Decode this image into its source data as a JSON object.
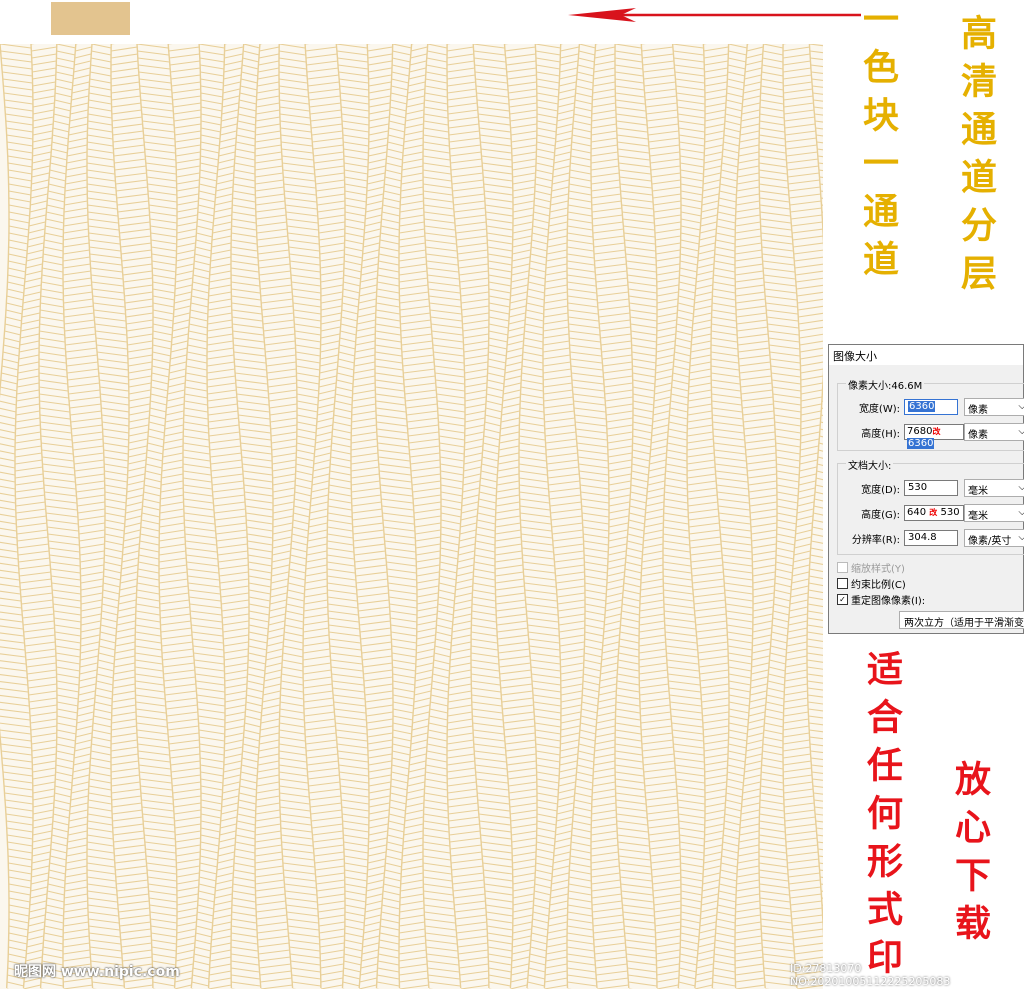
{
  "colors": {
    "gold": "#e3c48f",
    "line_gold": "#e8cf98",
    "brush_gold": "#e5b000",
    "brush_red": "#e8141b",
    "arrow_red": "#d8131c",
    "highlight": "#3573d3"
  },
  "annotations": {
    "one_color_text": "一色块一通道",
    "hd_text": "高清通道分层",
    "suitable_text": "适合任何形式印",
    "download_text": "放心下载"
  },
  "dialog": {
    "title": "图像大小",
    "pixel_dimensions_label": "像素大小:46.6M",
    "width_label": "宽度(W):",
    "width_value": "6360",
    "width_unit": "像素",
    "height_label": "高度(H):",
    "height_value_old": "7680",
    "height_mark": "改",
    "height_value": "6360",
    "height_unit": "像素",
    "document_size_label": "文档大小:",
    "doc_width_label": "宽度(D):",
    "doc_width_value": "530",
    "doc_width_unit": "毫米",
    "doc_height_label": "高度(G):",
    "doc_height_value_old": "640",
    "doc_height_mark": "改",
    "doc_height_value": "530",
    "doc_height_unit": "毫米",
    "resolution_label": "分辨率(R):",
    "resolution_value": "304.8",
    "resolution_unit": "像素/英寸",
    "scale_styles_label": "缩放样式(Y)",
    "constrain_label": "约束比例(C)",
    "resample_label": "重定图像像素(I):",
    "resample_method": "两次立方（适用于平滑渐变"
  },
  "watermark": {
    "site": "昵图网 www.nipic.com",
    "id": "ID:27813070 NO:20201005112225205083"
  }
}
